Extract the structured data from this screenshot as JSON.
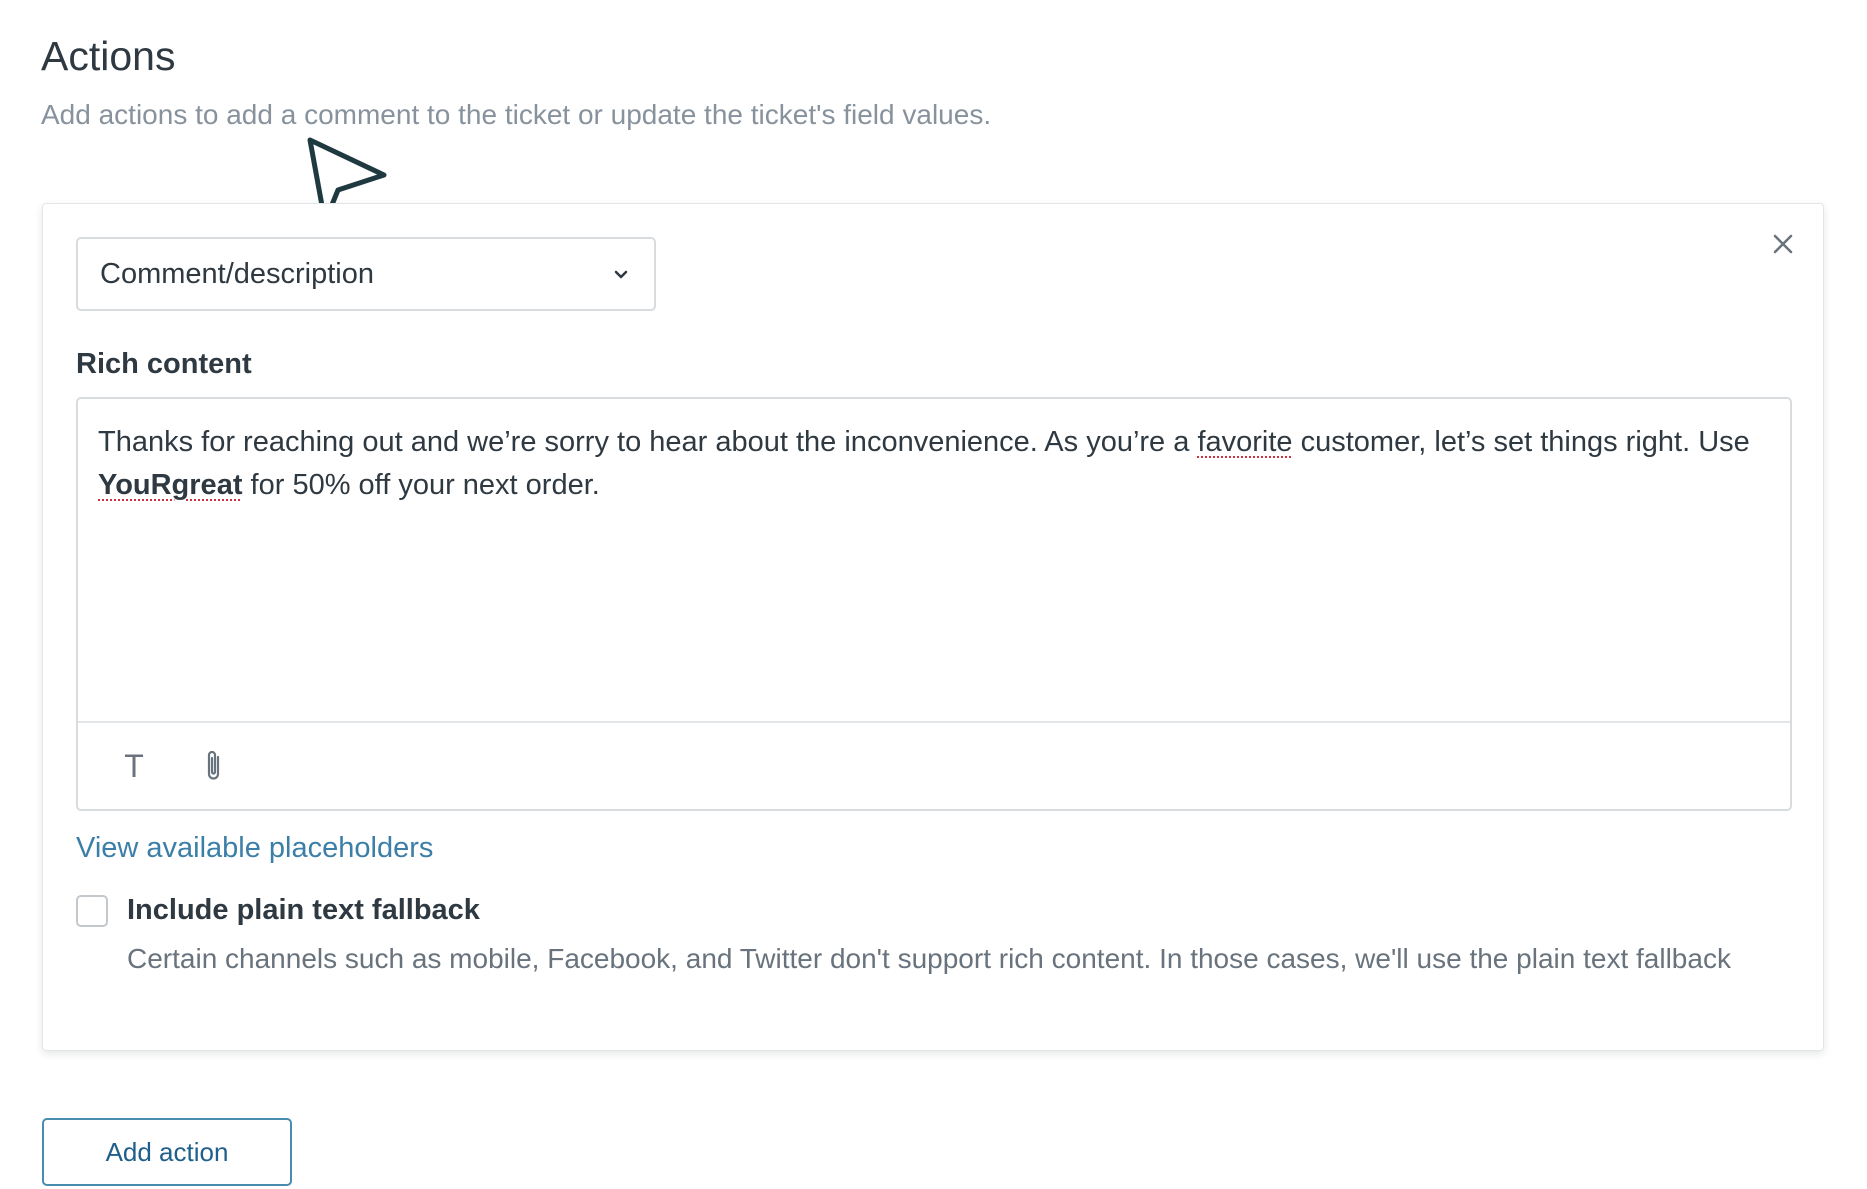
{
  "header": {
    "title": "Actions",
    "subtitle": "Add actions to add a comment to the ticket or update the ticket's field values."
  },
  "action_card": {
    "action_type": {
      "selected": "Comment/description"
    },
    "rich_content": {
      "label": "Rich content",
      "body": {
        "part1": "Thanks for reaching out and we’re sorry to hear about the inconvenience. As you’re a ",
        "misspelled1": "favorite",
        "part2": " customer, let’s set things right. Use ",
        "code": "YouRgreat",
        "part3": " for 50% off your next order."
      },
      "toolbar": {
        "text_format_glyph": "T"
      }
    },
    "placeholders_link": "View available placeholders",
    "plain_text_fallback": {
      "checked": false,
      "label": "Include plain text fallback",
      "hint": "Certain channels such as mobile, Facebook, and Twitter don't support rich content. In those cases, we'll use the plain text fallback"
    }
  },
  "footer": {
    "add_action_label": "Add action"
  },
  "colors": {
    "link": "#3b7fa8",
    "text": "#2f3941",
    "muted": "#87929d",
    "border": "#d8dcde",
    "spellcheck": "#cc3340"
  },
  "icons": [
    "cursor-arrow-icon",
    "close-icon",
    "chevron-down-icon",
    "text-format-icon",
    "paperclip-icon"
  ]
}
